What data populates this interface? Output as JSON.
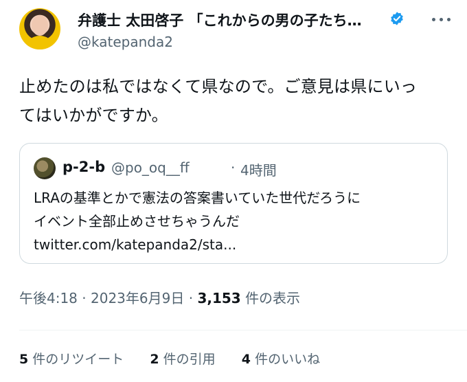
{
  "author": {
    "name": "弁護士 太田啓子 「これからの男の子たち…",
    "handle": "@katepanda2"
  },
  "tweet": {
    "text_line1": "止めたのは私ではなくて県なので。ご意見は県にいっ",
    "text_line2": "てはいかがですか。"
  },
  "quote": {
    "name": "p-2-b",
    "handle": "@po_oq__ff",
    "separator": "·",
    "time": "4時間",
    "line1": "LRAの基準とかで憲法の答案書いていた世代だろうに",
    "line2": "イベント全部止めさせちゃうんだ",
    "line3": "twitter.com/katepanda2/sta..."
  },
  "meta": {
    "time": "午後4:18",
    "date": "2023年6月9日",
    "views": "3,153",
    "views_label": "件の表示"
  },
  "stats": {
    "retweets_count": "5",
    "retweets_label": "件のリツイート",
    "quotes_count": "2",
    "quotes_label": "件の引用",
    "likes_count": "4",
    "likes_label": "件のいいね"
  },
  "icons": {
    "verified": "verified-badge-icon",
    "more": "more-options-icon"
  },
  "colors": {
    "verified_blue": "#1d9bf0",
    "secondary_text": "#536471",
    "border": "#cfd9de"
  }
}
